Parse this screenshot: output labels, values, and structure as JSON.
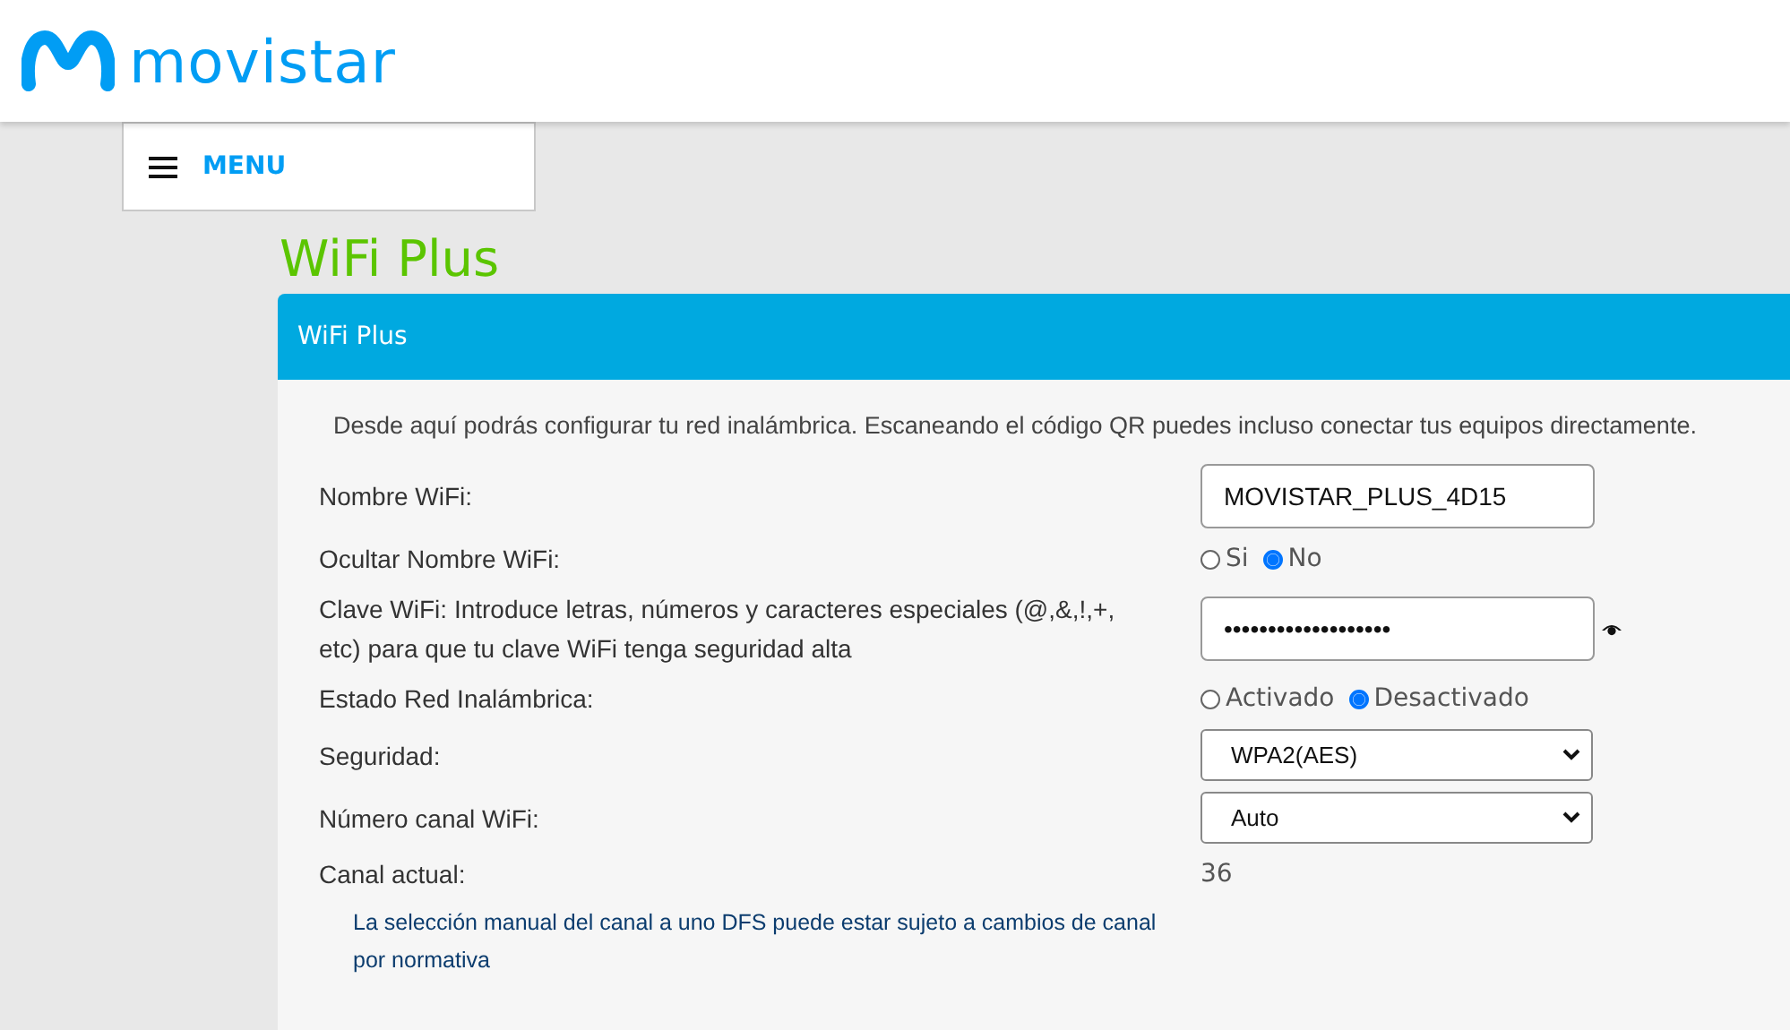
{
  "header": {
    "logo_text": "movistar"
  },
  "menu": {
    "label": "MENU"
  },
  "page_title": "WiFi Plus",
  "panel": {
    "title": "WiFi Plus",
    "description": "Desde aquí podrás configurar tu red inalámbrica. Escaneando el código QR puedes incluso conectar tus equipos directamente.",
    "rows": [
      {
        "kind": "text",
        "label": "Nombre WiFi:",
        "value": "MOVISTAR_PLUS_4D15"
      },
      {
        "kind": "radio",
        "label": "Ocultar Nombre WiFi:",
        "options": [
          {
            "label": "Si",
            "selected": false
          },
          {
            "label": "No",
            "selected": true
          }
        ]
      },
      {
        "kind": "password",
        "label": "Clave WiFi: Introduce letras, números y caracteres especiales (@,&,!,+, etc) para que tu clave WiFi tenga seguridad alta",
        "value": "•••••••••••••••••••"
      },
      {
        "kind": "radio",
        "label": "Estado Red Inalámbrica:",
        "options": [
          {
            "label": "Activado",
            "selected": false
          },
          {
            "label": "Desactivado",
            "selected": true
          }
        ]
      },
      {
        "kind": "select",
        "label": "Seguridad:",
        "value": "WPA2(AES)"
      },
      {
        "kind": "select",
        "label": "Número canal WiFi:",
        "value": "Auto"
      },
      {
        "kind": "value",
        "label": "Canal actual:",
        "value": "36"
      }
    ],
    "note": "La selección manual del canal a uno DFS puede estar sujeto a cambios de canal por normativa"
  }
}
